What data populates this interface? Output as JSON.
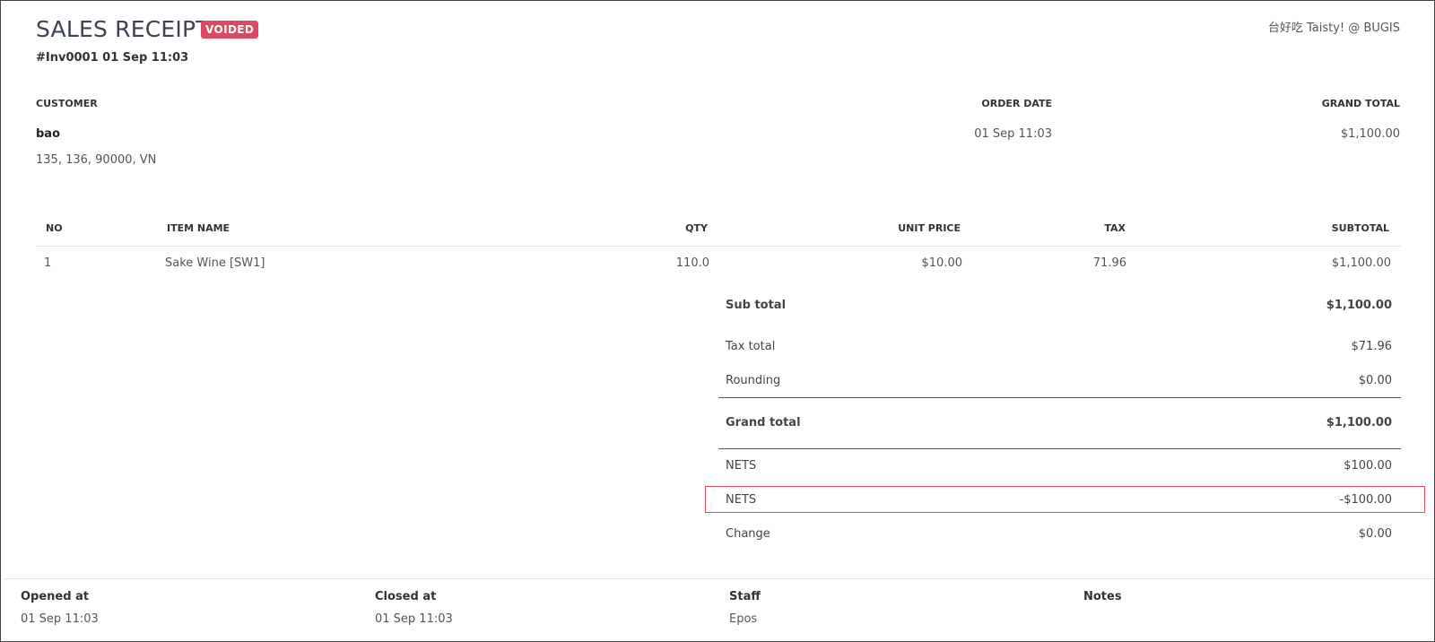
{
  "header": {
    "title": "SALES RECEIPT",
    "status_badge": "VOIDED",
    "invoice_line": "#Inv0001 01 Sep 11:03",
    "store_name": "台好吃 Taisty! @ BUGIS"
  },
  "info": {
    "customer_label": "CUSTOMER",
    "customer_name": "bao",
    "customer_address": "135, 136, 90000, VN",
    "order_date_label": "ORDER DATE",
    "order_date": "01 Sep 11:03",
    "grand_total_label": "GRAND TOTAL",
    "grand_total": "$1,100.00"
  },
  "items_table": {
    "columns": [
      "NO",
      "ITEM NAME",
      "QTY",
      "UNIT PRICE",
      "TAX",
      "SUBTOTAL"
    ],
    "rows": [
      {
        "no": "1",
        "name": "Sake Wine [SW1]",
        "qty": "110.0",
        "unit_price": "$10.00",
        "tax": "71.96",
        "subtotal": "$1,100.00"
      }
    ]
  },
  "summary": {
    "sub_total_label": "Sub total",
    "sub_total": "$1,100.00",
    "tax_total_label": "Tax total",
    "tax_total": "$71.96",
    "rounding_label": "Rounding",
    "rounding": "$0.00",
    "grand_total_label": "Grand total",
    "grand_total": "$1,100.00",
    "payments": [
      {
        "label": "NETS",
        "amount": "$100.00"
      },
      {
        "label": "NETS",
        "amount": "-$100.00"
      }
    ],
    "change_label": "Change",
    "change": "$0.00"
  },
  "footer": {
    "opened_label": "Opened at",
    "opened": "01 Sep 11:03",
    "closed_label": "Closed at",
    "closed": "01 Sep 11:03",
    "staff_label": "Staff",
    "staff": "Epos",
    "notes_label": "Notes"
  },
  "colors": {
    "badge": "#dc4a62",
    "highlight_border": "#e44b5a",
    "title": "#3c4350"
  }
}
